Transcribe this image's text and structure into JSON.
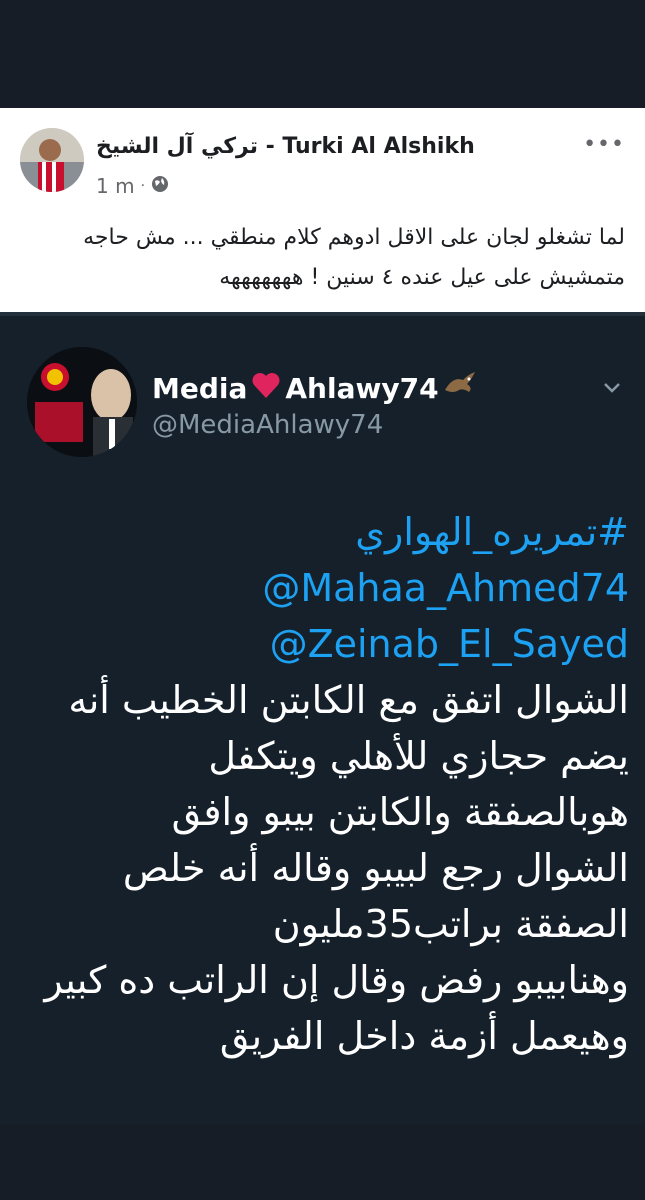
{
  "post": {
    "author": "تركي آل الشيخ - Turki Al Alshikh",
    "time": "1 m",
    "separator": "·",
    "more": "•••",
    "text_lines": [
      "لما تشغلو لجان على الاقل ادوهم كلام منطقي ... مش حاجه",
      "متمشيش على عيل عنده ٤ سنين ! هههههههه"
    ]
  },
  "tweet": {
    "name_start": "Media",
    "name_end": "Ahlawy74",
    "handle": "@MediaAhlawy74",
    "hashtag": "#تمريره_الهواري",
    "mentions": [
      "@Mahaa_Ahmed74",
      "@Zeinab_El_Sayed"
    ],
    "body_lines": [
      "الشوال اتفق مع الكابتن الخطيب أنه",
      "يضم حجازي للأهلي ويتكفل",
      "هوبالصفقة والكابتن بيبو وافق",
      "الشوال رجع لبيبو وقاله أنه خلص",
      "الصفقة براتب35مليون",
      "وهنابيبو رفض وقال إن الراتب ده كبير",
      "وهيعمل أزمة داخل الفريق"
    ]
  },
  "colors": {
    "page_bg": "#161d27",
    "card_bg": "#ffffff",
    "tweet_bg": "#15202b",
    "link": "#1da1f2",
    "heart": "#e0245e"
  },
  "icons": [
    "globe-icon",
    "more-options-icon",
    "heart-icon",
    "eagle-icon",
    "chevron-down-icon"
  ]
}
